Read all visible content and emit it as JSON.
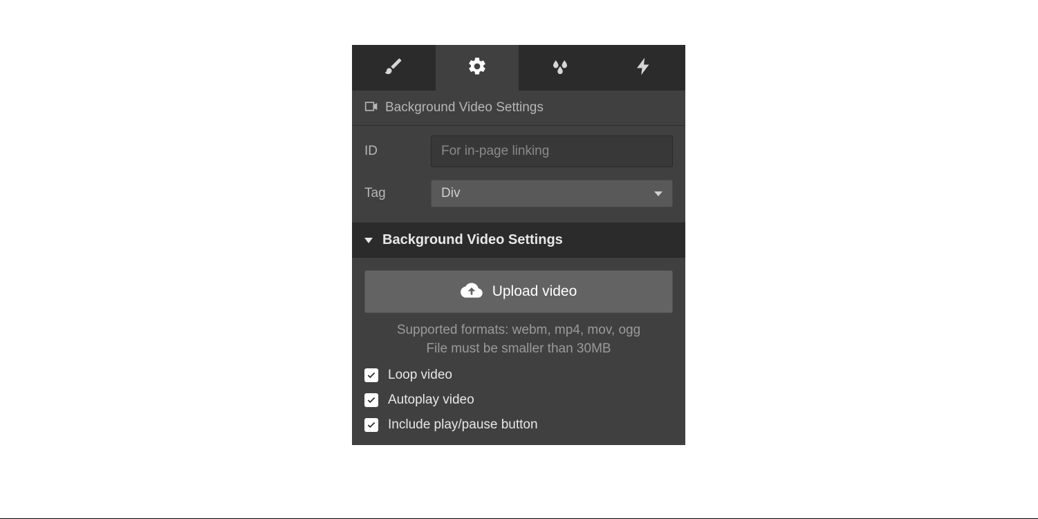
{
  "tabs": {
    "style_icon": "brush-icon",
    "settings_icon": "gear-icon",
    "effects_icon": "droplets-icon",
    "interactions_icon": "bolt-icon",
    "active_index": 1
  },
  "header": {
    "title": "Background Video Settings",
    "icon": "video-camera-icon"
  },
  "id_field": {
    "label": "ID",
    "placeholder": "For in-page linking",
    "value": ""
  },
  "tag_field": {
    "label": "Tag",
    "selected": "Div"
  },
  "section": {
    "title": "Background Video Settings",
    "expanded": true
  },
  "upload": {
    "button_label": "Upload video",
    "hint_line1": "Supported formats: webm, mp4, mov, ogg",
    "hint_line2": "File must be smaller than 30MB"
  },
  "checkboxes": {
    "loop": {
      "label": "Loop video",
      "checked": true
    },
    "autoplay": {
      "label": "Autoplay video",
      "checked": true
    },
    "playpause": {
      "label": "Include play/pause button",
      "checked": true
    }
  }
}
